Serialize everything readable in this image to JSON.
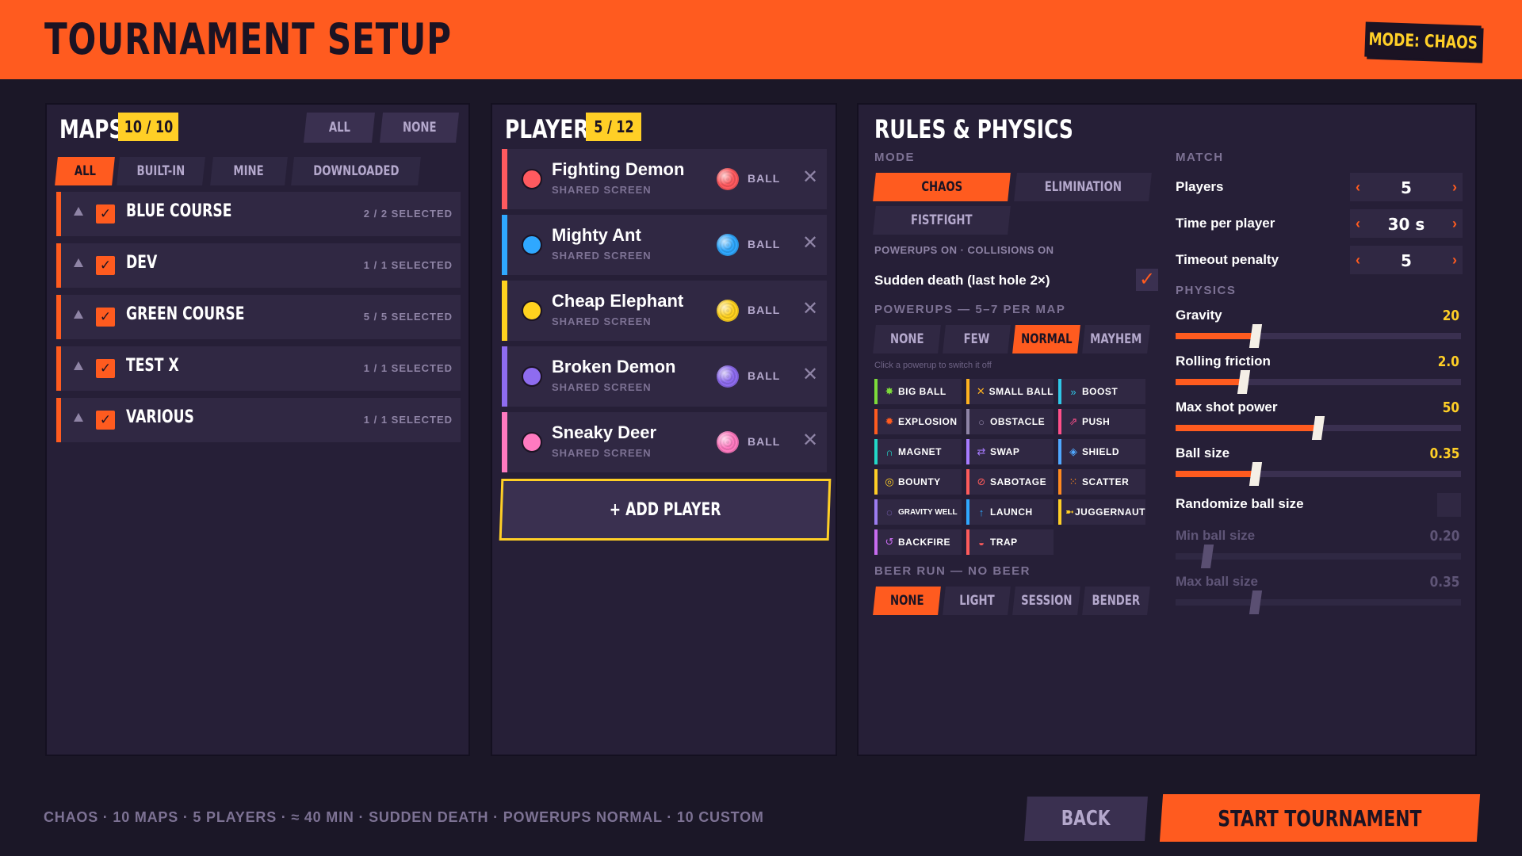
{
  "header": {
    "title": "TOURNAMENT SETUP",
    "mode_badge": "MODE: CHAOS"
  },
  "maps": {
    "title": "MAPS",
    "count": "10 / 10",
    "all_label": "ALL",
    "none_label": "NONE",
    "filters": [
      {
        "label": "ALL",
        "active": true
      },
      {
        "label": "BUILT-IN",
        "active": false
      },
      {
        "label": "MINE",
        "active": false
      },
      {
        "label": "DOWNLOADED",
        "active": false
      }
    ],
    "items": [
      {
        "name": "BLUE COURSE",
        "selected": "2 / 2 SELECTED"
      },
      {
        "name": "DEV",
        "selected": "1 / 1 SELECTED"
      },
      {
        "name": "GREEN COURSE",
        "selected": "5 / 5 SELECTED"
      },
      {
        "name": "TEST X",
        "selected": "1 / 1 SELECTED"
      },
      {
        "name": "VARIOUS",
        "selected": "1 / 1 SELECTED"
      }
    ]
  },
  "players": {
    "title": "PLAYERS",
    "count": "5 / 12",
    "items": [
      {
        "name": "Fighting Demon",
        "sub": "SHARED SCREEN",
        "ball": "BALL",
        "color": "#ff5a5f"
      },
      {
        "name": "Mighty Ant",
        "sub": "SHARED SCREEN",
        "ball": "BALL",
        "color": "#2fa8ff"
      },
      {
        "name": "Cheap Elephant",
        "sub": "SHARED SCREEN",
        "ball": "BALL",
        "color": "#ffd21f"
      },
      {
        "name": "Broken Demon",
        "sub": "SHARED SCREEN",
        "ball": "BALL",
        "color": "#8e6cf0"
      },
      {
        "name": "Sneaky Deer",
        "sub": "SHARED SCREEN",
        "ball": "BALL",
        "color": "#ff7ac0"
      }
    ],
    "add_label": "+ ADD PLAYER"
  },
  "rules": {
    "title": "RULES & PHYSICS",
    "mode_label": "MODE",
    "modes": [
      {
        "label": "CHAOS",
        "active": true
      },
      {
        "label": "ELIMINATION",
        "active": false
      },
      {
        "label": "FISTFIGHT",
        "active": false
      }
    ],
    "mode_note": "POWERUPS ON · COLLISIONS ON",
    "sudden_death_label": "Sudden death (last hole 2×)",
    "sudden_death_checked": true,
    "powerups_label": "POWERUPS — 5–7 PER MAP",
    "powerup_levels": [
      {
        "label": "NONE",
        "active": false
      },
      {
        "label": "FEW",
        "active": false
      },
      {
        "label": "NORMAL",
        "active": true
      },
      {
        "label": "MAYHEM",
        "active": false
      }
    ],
    "powerup_hint": "Click a powerup to switch it off",
    "powerups": [
      {
        "label": "BIG BALL",
        "icon": "big-ball-icon",
        "glyph": "✸",
        "color": "#7ddc3a"
      },
      {
        "label": "SMALL BALL",
        "icon": "small-ball-icon",
        "glyph": "✕",
        "color": "#ffb21f"
      },
      {
        "label": "BOOST",
        "icon": "boost-icon",
        "glyph": "»",
        "color": "#2fc7e8"
      },
      {
        "label": "EXPLOSION",
        "icon": "explosion-icon",
        "glyph": "✹",
        "color": "#ff5b1f"
      },
      {
        "label": "OBSTACLE",
        "icon": "obstacle-icon",
        "glyph": "○",
        "color": "#8f84a6"
      },
      {
        "label": "PUSH",
        "icon": "push-icon",
        "glyph": "⇗",
        "color": "#ff4f8a"
      },
      {
        "label": "MAGNET",
        "icon": "magnet-icon",
        "glyph": "∩",
        "color": "#22d8c8"
      },
      {
        "label": "SWAP",
        "icon": "swap-icon",
        "glyph": "⇄",
        "color": "#a77bff"
      },
      {
        "label": "SHIELD",
        "icon": "shield-icon",
        "glyph": "◈",
        "color": "#4fa8ff"
      },
      {
        "label": "BOUNTY",
        "icon": "bounty-icon",
        "glyph": "◎",
        "color": "#ffcf26"
      },
      {
        "label": "SABOTAGE",
        "icon": "sabotage-icon",
        "glyph": "⊘",
        "color": "#ff5b5b"
      },
      {
        "label": "SCATTER",
        "icon": "scatter-icon",
        "glyph": "⁙",
        "color": "#ff8a1f"
      },
      {
        "label": "GRAVITY WELL",
        "icon": "gravity-well-icon",
        "glyph": "◌",
        "color": "#9c7cf0"
      },
      {
        "label": "LAUNCH",
        "icon": "launch-icon",
        "glyph": "↑",
        "color": "#2fa8ff"
      },
      {
        "label": "JUGGERNAUT",
        "icon": "juggernaut-icon",
        "glyph": "➼",
        "color": "#ffcf26"
      },
      {
        "label": "BACKFIRE",
        "icon": "backfire-icon",
        "glyph": "↺",
        "color": "#c86cf0"
      },
      {
        "label": "TRAP",
        "icon": "trap-icon",
        "glyph": "◒",
        "color": "#ff5b5b"
      }
    ],
    "beer_label": "BEER RUN — NO BEER",
    "beer_levels": [
      {
        "label": "NONE",
        "active": true
      },
      {
        "label": "LIGHT",
        "active": false
      },
      {
        "label": "SESSION",
        "active": false
      },
      {
        "label": "BENDER",
        "active": false
      }
    ],
    "match_label": "MATCH",
    "match": [
      {
        "label": "Players",
        "value": "5"
      },
      {
        "label": "Time per player",
        "value": "30 s"
      },
      {
        "label": "Timeout penalty",
        "value": "5"
      }
    ],
    "physics_label": "PHYSICS",
    "sliders": [
      {
        "label": "Gravity",
        "value": "20",
        "level": 0.28,
        "active": true
      },
      {
        "label": "Rolling friction",
        "value": "2.0",
        "level": 0.24,
        "active": true
      },
      {
        "label": "Max shot power",
        "value": "50",
        "level": 0.5,
        "active": true
      },
      {
        "label": "Ball size",
        "value": "0.35",
        "level": 0.28,
        "active": true
      }
    ],
    "randomize_label": "Randomize ball size",
    "randomize_checked": false,
    "range_sliders": [
      {
        "label": "Min ball size",
        "value": "0.20",
        "level": 0.11
      },
      {
        "label": "Max ball size",
        "value": "0.35",
        "level": 0.28
      }
    ]
  },
  "footer": {
    "summary": "CHAOS · 10 MAPS · 5 PLAYERS · ≈ 40 MIN · SUDDEN DEATH · POWERUPS NORMAL · 10 CUSTOM",
    "back_label": "BACK",
    "start_label": "START TOURNAMENT"
  }
}
